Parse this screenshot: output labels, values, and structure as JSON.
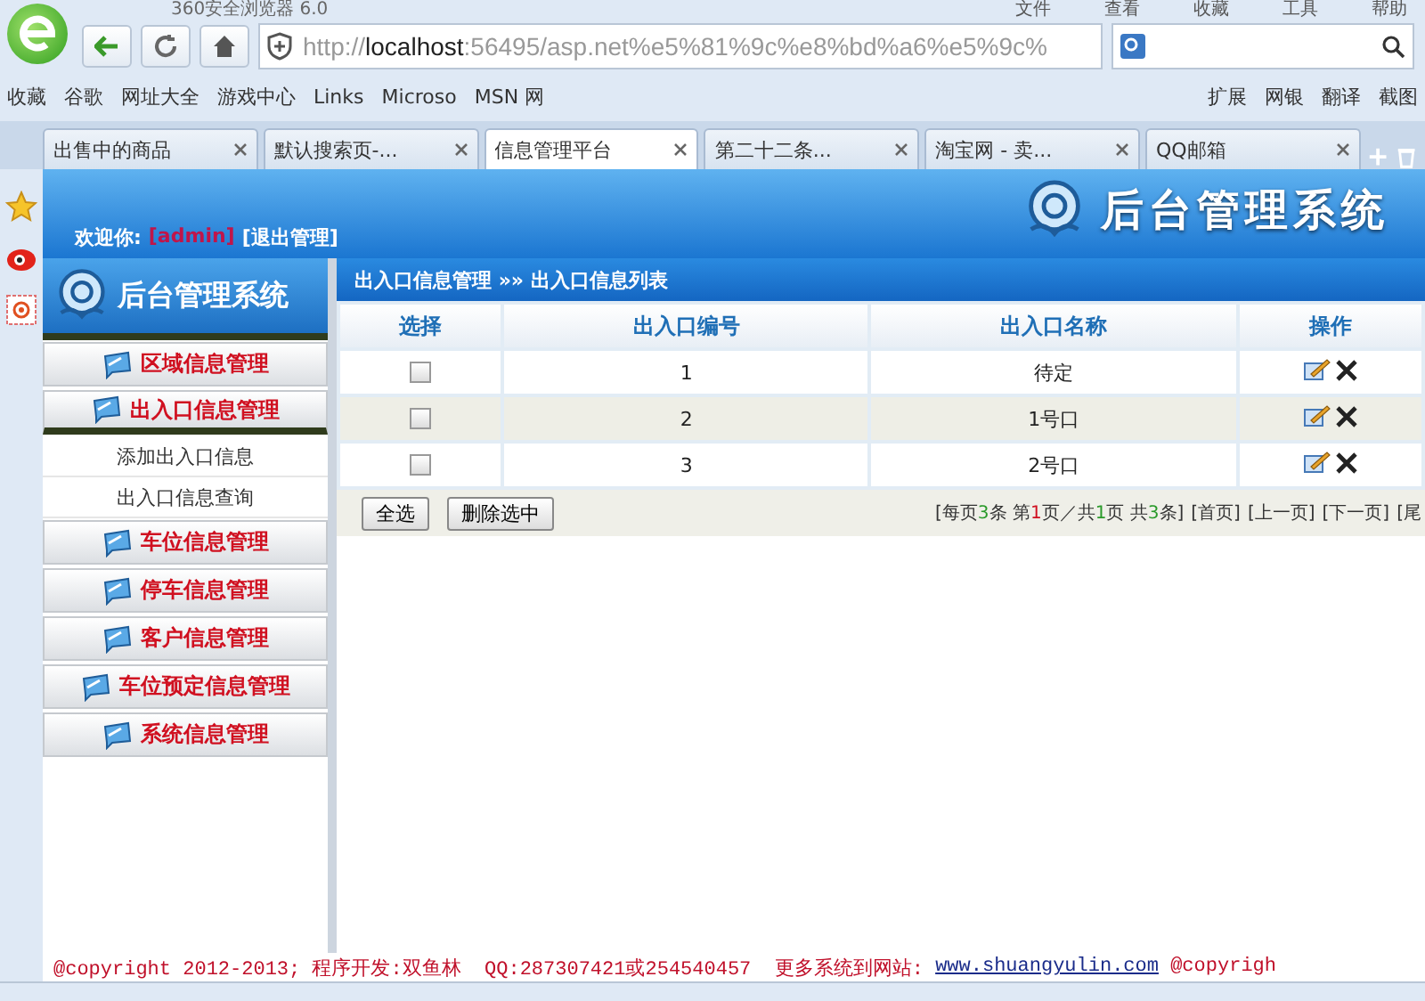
{
  "browser": {
    "title": "360安全浏览器 6.0",
    "menu": [
      "文件",
      "查看",
      "收藏",
      "工具",
      "帮助"
    ],
    "address": {
      "host_prefix": "http://",
      "host": "localhost",
      "rest": ":56495/asp.net%e5%81%9c%e8%bd%a6%e5%9c%"
    },
    "bookmarks": [
      "收藏",
      "谷歌",
      "网址大全",
      "游戏中心",
      "Links",
      "Microso",
      "MSN 网"
    ],
    "bookmark_tools": [
      "扩展",
      "网银",
      "翻译",
      "截图"
    ],
    "tabs": [
      {
        "label": "出售中的商品",
        "selected": false
      },
      {
        "label": "默认搜索页-...",
        "selected": false
      },
      {
        "label": "信息管理平台",
        "selected": true
      },
      {
        "label": "第二十二条...",
        "selected": false
      },
      {
        "label": "淘宝网 - 卖...",
        "selected": false
      },
      {
        "label": "QQ邮箱",
        "selected": false
      }
    ]
  },
  "header": {
    "welcome": "欢迎你:",
    "user": "[admin]",
    "logout": "[退出管理]",
    "logo": "后台管理系统"
  },
  "sidebar": {
    "logo": "后台管理系统",
    "groups": [
      {
        "label": "区域信息管理",
        "expanded": false
      },
      {
        "label": "出入口信息管理",
        "expanded": true,
        "children": [
          {
            "label": "添加出入口信息"
          },
          {
            "label": "出入口信息查询"
          }
        ]
      },
      {
        "label": "车位信息管理",
        "expanded": false
      },
      {
        "label": "停车信息管理",
        "expanded": false
      },
      {
        "label": "客户信息管理",
        "expanded": false
      },
      {
        "label": "车位预定信息管理",
        "expanded": false
      },
      {
        "label": "系统信息管理",
        "expanded": false
      }
    ]
  },
  "breadcrumb": "出入口信息管理 »» 出入口信息列表",
  "table": {
    "columns": [
      "选择",
      "出入口编号",
      "出入口名称",
      "操作"
    ],
    "rows": [
      {
        "checked": false,
        "number": "1",
        "name": "待定"
      },
      {
        "checked": false,
        "number": "2",
        "name": "1号口"
      },
      {
        "checked": false,
        "number": "3",
        "name": "2号口"
      }
    ]
  },
  "actions": [
    "全选",
    "删除选中"
  ],
  "pager": {
    "info": [
      {
        "text": "[每页",
        "kind": "plain"
      },
      {
        "text": "3",
        "kind": "count"
      },
      {
        "text": "条 第",
        "kind": "plain"
      },
      {
        "text": "1",
        "kind": "current"
      },
      {
        "text": "页／共",
        "kind": "plain"
      },
      {
        "text": "1",
        "kind": "count"
      },
      {
        "text": "页 共",
        "kind": "plain"
      },
      {
        "text": "3",
        "kind": "count"
      },
      {
        "text": "条]",
        "kind": "plain"
      }
    ],
    "links": [
      "[首页]",
      "[上一页]",
      "[下一页]",
      "[尾"
    ]
  },
  "footer": {
    "text": "@copyright 2012-2013; 程序开发:双鱼林  QQ:287307421或254540457  更多系统到网站: ",
    "link": "www.shuangyulin.com",
    "tail": "@copyrigh"
  }
}
